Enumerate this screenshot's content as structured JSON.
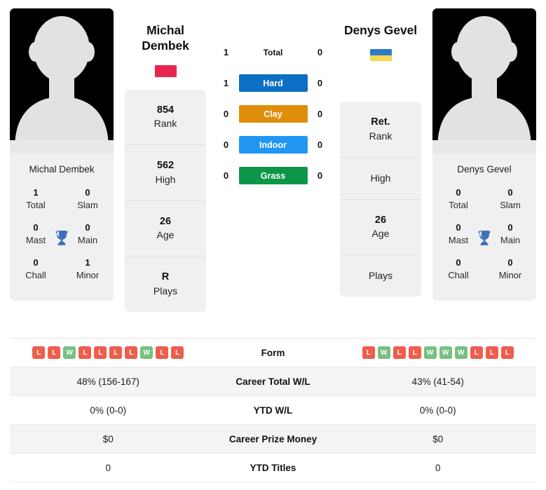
{
  "players": {
    "left": {
      "name": "Michal Dembek",
      "name_line1": "Michal",
      "name_line2": "Dembek",
      "flag_name": "poland-flag",
      "flag_top": "#E8254F",
      "flag_bottom": "#E8254F",
      "titles": {
        "total_value": "1",
        "total_label": "Total",
        "slam_value": "0",
        "slam_label": "Slam",
        "mast_value": "0",
        "mast_label": "Mast",
        "main_value": "0",
        "main_label": "Main",
        "chall_value": "0",
        "chall_label": "Chall",
        "minor_value": "1",
        "minor_label": "Minor"
      },
      "attributes": [
        {
          "value": "854",
          "label": "Rank"
        },
        {
          "value": "562",
          "label": "High"
        },
        {
          "value": "26",
          "label": "Age"
        },
        {
          "value": "R",
          "label": "Plays"
        }
      ],
      "surface_scores": {
        "total": "1",
        "hard": "1",
        "clay": "0",
        "indoor": "0",
        "grass": "0"
      },
      "form": [
        "L",
        "L",
        "W",
        "L",
        "L",
        "L",
        "L",
        "W",
        "L",
        "L"
      ],
      "career_total_wl": "48% (156-167)",
      "ytd_wl": "0% (0-0)",
      "career_prize_money": "$0",
      "ytd_titles": "0"
    },
    "right": {
      "name": "Denys Gevel",
      "name_line1": "Denys Gevel",
      "name_line2": "",
      "flag_name": "ukraine-flag",
      "flag_top": "#2B7BCA",
      "flag_bottom": "#F7D84B",
      "titles": {
        "total_value": "0",
        "total_label": "Total",
        "slam_value": "0",
        "slam_label": "Slam",
        "mast_value": "0",
        "mast_label": "Mast",
        "main_value": "0",
        "main_label": "Main",
        "chall_value": "0",
        "chall_label": "Chall",
        "minor_value": "0",
        "minor_label": "Minor"
      },
      "attributes": [
        {
          "value": "Ret.",
          "label": "Rank"
        },
        {
          "value": "",
          "label": "High"
        },
        {
          "value": "26",
          "label": "Age"
        },
        {
          "value": "",
          "label": "Plays"
        }
      ],
      "surface_scores": {
        "total": "0",
        "hard": "0",
        "clay": "0",
        "indoor": "0",
        "grass": "0"
      },
      "form": [
        "L",
        "W",
        "L",
        "L",
        "W",
        "W",
        "W",
        "L",
        "L",
        "L"
      ],
      "career_total_wl": "43% (41-54)",
      "ytd_wl": "0% (0-0)",
      "career_prize_money": "$0",
      "ytd_titles": "0"
    }
  },
  "surfaces": [
    {
      "key": "total",
      "label": "Total",
      "color": "transparent",
      "text_color": "#151515"
    },
    {
      "key": "hard",
      "label": "Hard",
      "color": "#0B6FC4",
      "text_color": "#ffffff"
    },
    {
      "key": "clay",
      "label": "Clay",
      "color": "#E08E0B",
      "text_color": "#ffffff"
    },
    {
      "key": "indoor",
      "label": "Indoor",
      "color": "#2196F3",
      "text_color": "#ffffff"
    },
    {
      "key": "grass",
      "label": "Grass",
      "color": "#0D9648",
      "text_color": "#ffffff"
    }
  ],
  "stats_rows": [
    {
      "label": "Form",
      "key": "form"
    },
    {
      "label": "Career Total W/L",
      "key": "career_total_wl"
    },
    {
      "label": "YTD W/L",
      "key": "ytd_wl"
    },
    {
      "label": "Career Prize Money",
      "key": "career_prize_money"
    },
    {
      "label": "YTD Titles",
      "key": "ytd_titles"
    }
  ],
  "colors": {
    "form_win": "#78C082",
    "form_loss": "#EF5D4C",
    "card_bg": "#F0F0F0",
    "row_alt_bg": "#F4F4F4",
    "trophy": "#3E72B8"
  }
}
